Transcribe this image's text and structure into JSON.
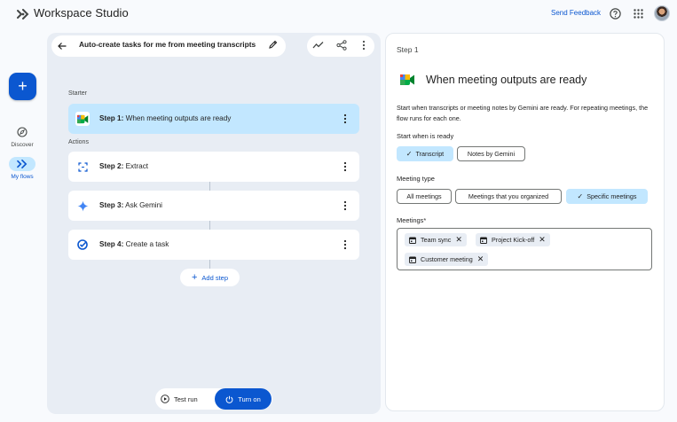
{
  "app": {
    "title": "Workspace Studio",
    "logo_icon": "workspace-studio-logo-icon"
  },
  "header": {
    "send_feedback": "Send Feedback",
    "help_icon": "help-icon",
    "apps_icon": "apps-grid-icon",
    "avatar_icon": "user-avatar"
  },
  "rail": {
    "create_icon": "plus-icon",
    "items": [
      {
        "label": "Discover",
        "icon": "compass-icon"
      },
      {
        "label": "My flows",
        "icon": "flows-icon",
        "active": true
      }
    ]
  },
  "flow": {
    "title": "Auto-create tasks for me from meeting transcripts",
    "starter_label": "Starter",
    "actions_label": "Actions",
    "steps": [
      {
        "number": "Step 1:",
        "name": "When meeting outputs are ready",
        "icon": "google-meet-icon",
        "active": true
      },
      {
        "number": "Step 2:",
        "name": "Extract",
        "icon": "extract-icon"
      },
      {
        "number": "Step 3:",
        "name": "Ask Gemini",
        "icon": "gemini-icon"
      },
      {
        "number": "Step 4:",
        "name": "Create a task",
        "icon": "tasks-icon"
      }
    ],
    "add_step": "Add step",
    "test_run": "Test run",
    "turn_on": "Turn on"
  },
  "detail": {
    "step_label": "Step 1",
    "title": "When meeting outputs are ready",
    "description": "Start when transcripts or meeting notes by Gemini are ready. For repeating meetings, the flow runs for each one.",
    "start_when_label": "Start when is ready",
    "start_options": [
      {
        "label": "Transcript",
        "selected": true
      },
      {
        "label": "Notes by Gemini",
        "selected": false
      }
    ],
    "meeting_type_label": "Meeting type",
    "meeting_types": [
      {
        "label": "All meetings",
        "selected": false
      },
      {
        "label": "Meetings that you organized",
        "selected": false
      },
      {
        "label": "Specific meetings",
        "selected": true
      }
    ],
    "meetings_label": "Meetings*",
    "meetings": [
      "Team sync",
      "Project Kick-off",
      "Customer meeting"
    ]
  },
  "colors": {
    "accent": "#0b57d0",
    "selected_bg": "#c2e7ff",
    "panel_bg": "#e8edf4",
    "page_bg": "#f8fafd"
  }
}
